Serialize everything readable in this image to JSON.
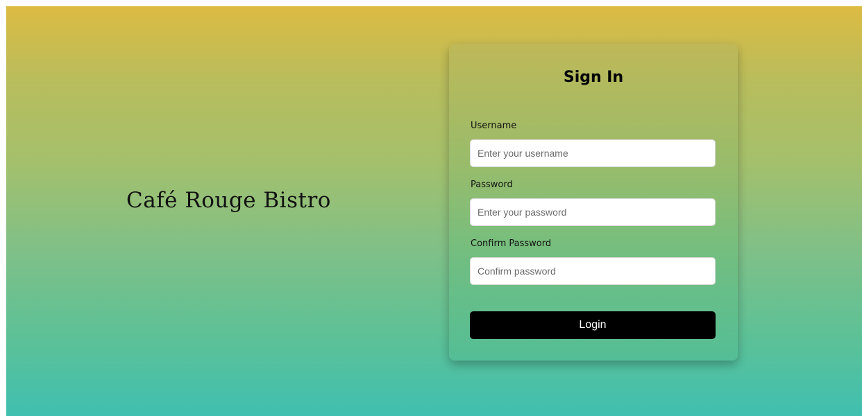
{
  "brand": {
    "name": "Café Rouge Bistro"
  },
  "signin": {
    "title": "Sign In",
    "username": {
      "label": "Username",
      "placeholder": "Enter your username"
    },
    "password": {
      "label": "Password",
      "placeholder": "Enter your password"
    },
    "confirm": {
      "label": "Confirm Password",
      "placeholder": "Confirm password"
    },
    "submit_label": "Login"
  },
  "colors": {
    "gradient_top": "#dcbb42",
    "gradient_bottom": "#40c0b0",
    "button": "#000000"
  }
}
